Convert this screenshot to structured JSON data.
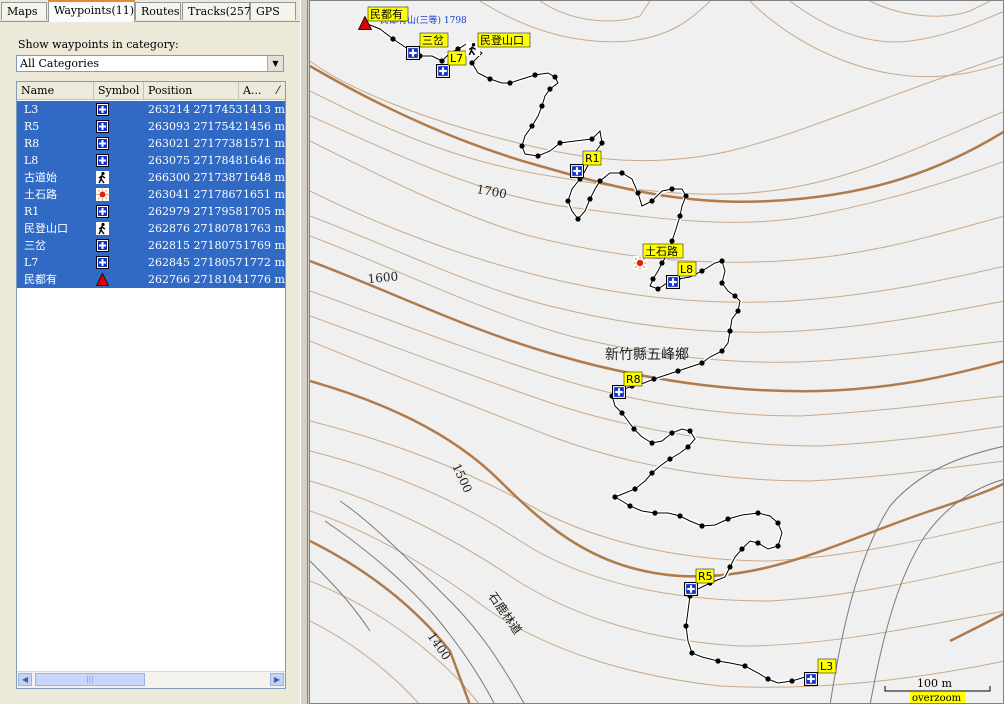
{
  "tabs": [
    {
      "label": "Maps",
      "active": false
    },
    {
      "label": "Waypoints(11)",
      "active": true
    },
    {
      "label": "Routes",
      "active": false
    },
    {
      "label": "Tracks(257)",
      "active": false
    },
    {
      "label": "GPS",
      "active": false
    }
  ],
  "category": {
    "label": "Show waypoints in category:",
    "selected": "All Categories"
  },
  "columns": [
    "Name",
    "Symbol",
    "Position",
    "A..."
  ],
  "waypoints": [
    {
      "name": "L3",
      "symbol": "blue-cross-icon",
      "position": "263214 2717453",
      "alt": "1413 m"
    },
    {
      "name": "R5",
      "symbol": "blue-cross-icon",
      "position": "263093 2717542",
      "alt": "1456 m"
    },
    {
      "name": "R8",
      "symbol": "blue-cross-icon",
      "position": "263021 2717738",
      "alt": "1571 m"
    },
    {
      "name": "L8",
      "symbol": "blue-cross-icon",
      "position": "263075 2717848",
      "alt": "1646 m"
    },
    {
      "name": "古道始",
      "symbol": "hiker-icon",
      "position": "266300 2717387",
      "alt": "1648 m"
    },
    {
      "name": "土石路",
      "symbol": "sun-icon",
      "position": "263041 2717867",
      "alt": "1651 m"
    },
    {
      "name": "R1",
      "symbol": "blue-cross-icon",
      "position": "262979 2717958",
      "alt": "1705 m"
    },
    {
      "name": "民登山口",
      "symbol": "hiker-icon",
      "position": "262876 2718078",
      "alt": "1763 m"
    },
    {
      "name": "三岔",
      "symbol": "blue-cross-icon",
      "position": "262815 2718075",
      "alt": "1769 m"
    },
    {
      "name": "L7",
      "symbol": "blue-cross-icon",
      "position": "262845 2718057",
      "alt": "1772 m"
    },
    {
      "name": "民都有",
      "symbol": "red-triangle-icon",
      "position": "262766 2718104",
      "alt": "1776 m"
    }
  ],
  "map": {
    "contour_labels": [
      "1700",
      "1600",
      "1500",
      "1400"
    ],
    "place_label": "新竹縣五峰鄉",
    "road_label": "石鹿林道",
    "summit_note": "民都有山(三等) 1798",
    "scale_text": "100 m",
    "overzoom_text": "overzoom",
    "colors": {
      "contour": "#c9a98a",
      "index_contour": "#b07a4a",
      "road": "#7a7a7a",
      "track": "#000000",
      "label_bg": "#ffff00"
    }
  }
}
